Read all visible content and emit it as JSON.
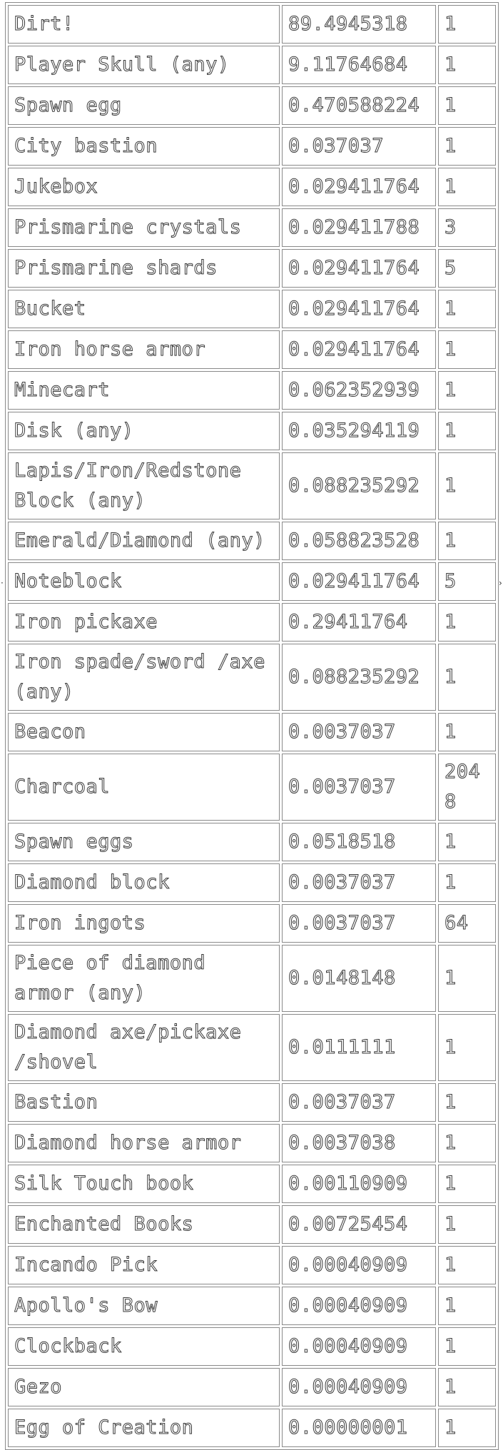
{
  "table": {
    "rows": [
      {
        "item": "Dirt!",
        "chance": "89.4945318",
        "count": "1"
      },
      {
        "item": "Player Skull (any)",
        "chance": "9.11764684",
        "count": "1"
      },
      {
        "item": "Spawn egg",
        "chance": "0.470588224",
        "count": "1"
      },
      {
        "item": "City bastion",
        "chance": "0.037037",
        "count": "1"
      },
      {
        "item": "Jukebox",
        "chance": "0.029411764",
        "count": "1"
      },
      {
        "item": "Prismarine crystals",
        "chance": "0.029411788",
        "count": "3"
      },
      {
        "item": "Prismarine shards",
        "chance": "0.029411764",
        "count": "5"
      },
      {
        "item": "Bucket",
        "chance": "0.029411764",
        "count": "1"
      },
      {
        "item": "Iron horse armor",
        "chance": "0.029411764",
        "count": "1"
      },
      {
        "item": "Minecart",
        "chance": "0.062352939",
        "count": "1"
      },
      {
        "item": "Disk (any)",
        "chance": "0.035294119",
        "count": "1"
      },
      {
        "item": "Lapis/Iron/Redstone Block (any)",
        "chance": "0.088235292",
        "count": "1"
      },
      {
        "item": "Emerald/Diamond (any)",
        "chance": "0.058823528",
        "count": "1"
      },
      {
        "item": "Noteblock",
        "chance": "0.029411764",
        "count": "5"
      },
      {
        "item": "Iron pickaxe",
        "chance": "0.29411764",
        "count": "1"
      },
      {
        "item": "Iron spade/sword /axe (any)",
        "chance": "0.088235292",
        "count": "1"
      },
      {
        "item": "Beacon",
        "chance": "0.0037037",
        "count": "1"
      },
      {
        "item": "Charcoal",
        "chance": "0.0037037",
        "count": "2048"
      },
      {
        "item": "Spawn eggs",
        "chance": "0.0518518",
        "count": "1"
      },
      {
        "item": "Diamond block",
        "chance": "0.0037037",
        "count": "1"
      },
      {
        "item": "Iron ingots",
        "chance": "0.0037037",
        "count": "64"
      },
      {
        "item": "Piece of diamond armor (any)",
        "chance": "0.0148148",
        "count": "1"
      },
      {
        "item": "Diamond axe/pickaxe /shovel",
        "chance": "0.0111111",
        "count": "1"
      },
      {
        "item": "Bastion",
        "chance": "0.0037037",
        "count": "1"
      },
      {
        "item": "Diamond horse armor",
        "chance": "0.0037038",
        "count": "1"
      },
      {
        "item": "Silk Touch book",
        "chance": "0.00110909",
        "count": "1"
      },
      {
        "item": "Enchanted Books",
        "chance": "0.00725454",
        "count": "1"
      },
      {
        "item": "Incando Pick",
        "chance": "0.00040909",
        "count": "1"
      },
      {
        "item": "Apollo's Bow",
        "chance": "0.00040909",
        "count": "1"
      },
      {
        "item": "Clockback",
        "chance": "0.00040909",
        "count": "1"
      },
      {
        "item": "Gezo",
        "chance": "0.00040909",
        "count": "1"
      },
      {
        "item": "Egg of Creation",
        "chance": "0.00000001",
        "count": "1"
      }
    ]
  }
}
